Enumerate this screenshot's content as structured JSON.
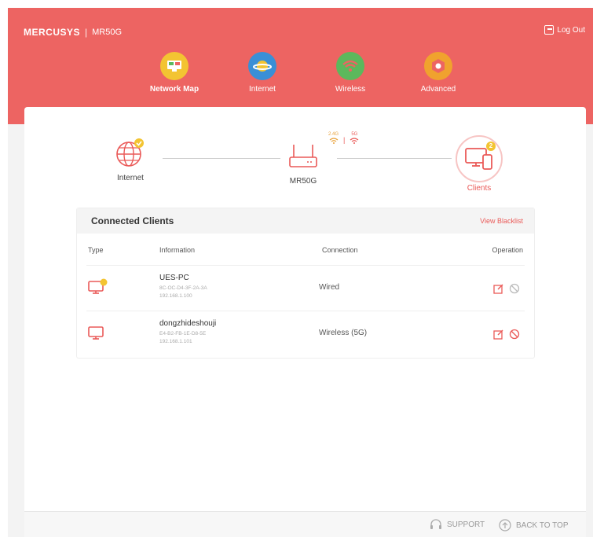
{
  "header": {
    "brand": "MERCUSYS",
    "separator": "|",
    "model": "MR50G",
    "logout": "Log Out"
  },
  "nav": {
    "items": [
      {
        "label": "Network Map",
        "icon": "network-map-icon",
        "color": "#f3c432",
        "active": true
      },
      {
        "label": "Internet",
        "icon": "internet-planet-icon",
        "color": "#3a8fd6",
        "active": false
      },
      {
        "label": "Wireless",
        "icon": "wifi-icon",
        "color": "#5cb85c",
        "active": false
      },
      {
        "label": "Advanced",
        "icon": "gear-icon",
        "color": "#f0a22e",
        "active": false
      }
    ]
  },
  "topology": {
    "internet": "Internet",
    "router": "MR50G",
    "clients": "Clients",
    "clients_count": "2",
    "band_24": "2.4G",
    "band_5": "5G",
    "band_sep": "|"
  },
  "connected_clients": {
    "title": "Connected Clients",
    "blacklist_link": "View Blacklist",
    "columns": [
      "Type",
      "Information",
      "Connection",
      "Operation"
    ],
    "rows": [
      {
        "name": "UES-PC",
        "mac": "8C-OC-D4-3F-2A-3A",
        "ip": "192.168.1.100",
        "connection": "Wired",
        "badge": "✓"
      },
      {
        "name": "dongzhideshouji",
        "mac": "E4-B2-FB-1E-D8-5E",
        "ip": "192.168.1.101",
        "connection": "Wireless (5G)"
      }
    ]
  },
  "footer": {
    "support": "SUPPORT",
    "back_to_top": "BACK TO TOP"
  },
  "colors": {
    "brand_red": "#ed6462",
    "accent_red": "#ea5a58",
    "badge_yellow": "#f3c432"
  }
}
